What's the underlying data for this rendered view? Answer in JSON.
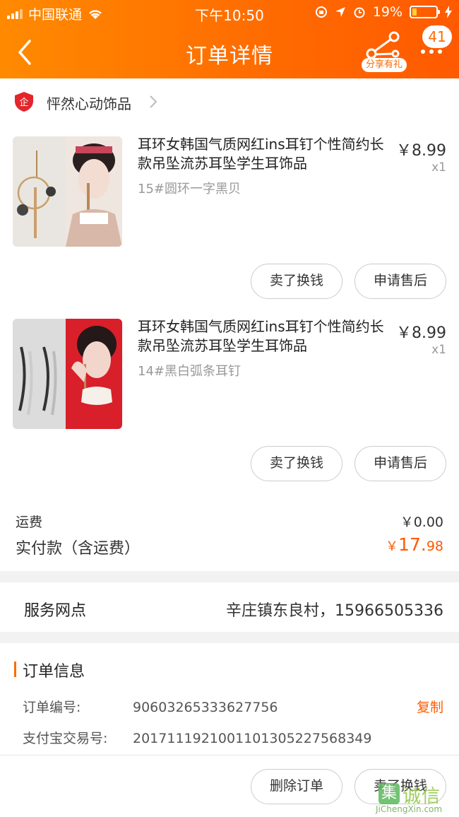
{
  "status_bar": {
    "carrier": "中国联通",
    "time": "下午10:50",
    "battery_percent": "19%",
    "battery_level": 0.19
  },
  "nav": {
    "title": "订单详情",
    "share_label": "分享有礼",
    "message_count": "41",
    "icons": [
      "back-arrow-icon",
      "share-icon",
      "more-icon"
    ]
  },
  "shop": {
    "name": "怦然心动饰品",
    "icon": "enterprise-shield-icon"
  },
  "items": [
    {
      "title": "耳环女韩国气质网红ins耳钉个性简约长款吊坠流苏耳坠学生耳饰品",
      "price": "￥8.99",
      "qty": "x1",
      "spec": "15#圆环一字黑贝",
      "buttons": [
        "卖了换钱",
        "申请售后"
      ]
    },
    {
      "title": "耳环女韩国气质网红ins耳钉个性简约长款吊坠流苏耳坠学生耳饰品",
      "price": "￥8.99",
      "qty": "x1",
      "spec": "14#黑白弧条耳钉",
      "buttons": [
        "卖了换钱",
        "申请售后"
      ]
    }
  ],
  "totals": {
    "shipping_label": "运费",
    "shipping_value": "￥0.00",
    "paid_label": "实付款（含运费）",
    "paid_currency": "￥",
    "paid_int": "17.",
    "paid_dec": "98"
  },
  "service": {
    "label": "服务网点",
    "value": "辛庄镇东良村，15966505336"
  },
  "order_info": {
    "title": "订单信息",
    "order_no_label": "订单编号:",
    "order_no": "90603265333627756",
    "copy_label": "复制",
    "alipay_label": "支付宝交易号:",
    "alipay_no": "2017111921001101305227568349",
    "buttons": [
      "删除订单",
      "卖了换钱"
    ]
  },
  "watermark": {
    "icon_char": "集",
    "text": "诚信",
    "url": "JiChengXin.com"
  },
  "colors": {
    "accent": "#ff6a00",
    "price_red": "#ff5a00"
  }
}
